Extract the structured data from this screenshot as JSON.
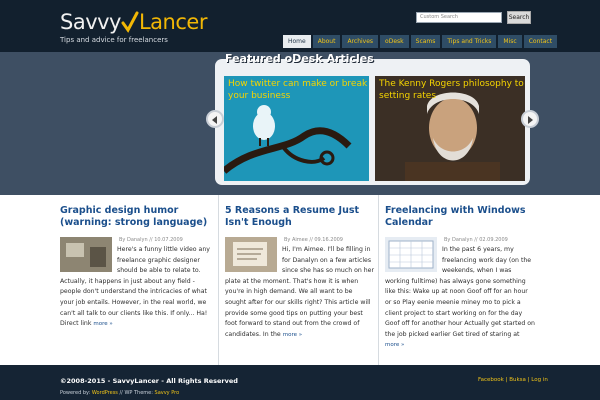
{
  "site": {
    "logo_savvy": "Savvy",
    "logo_lancer": "Lancer",
    "tagline": "Tips and advice for freelancers",
    "brand_color": "#f2b705"
  },
  "search": {
    "placeholder": "Custom Search",
    "button_label": "Search"
  },
  "nav": {
    "items": [
      "Home",
      "About",
      "Archives",
      "oDesk",
      "Scams",
      "Tips and Tricks",
      "Misc",
      "Contact"
    ],
    "active": "Home"
  },
  "featured": {
    "title": "Featured oDesk Articles",
    "slides": [
      {
        "caption": "How twitter can make or break your business"
      },
      {
        "caption": "The Kenny Rogers philosophy to setting rates"
      }
    ],
    "prev_icon": "arrow-left-icon",
    "next_icon": "arrow-right-icon"
  },
  "posts": [
    {
      "title": "Graphic design humor (warning: strong language)",
      "meta": "By Danalyn // 10.07.2009",
      "excerpt": "Here's a funny little video any freelance graphic designer should be able to relate to. Actually, it happens in just about any field - people don't understand the intricacies of what your job entails.  However, in the real world, we can't all talk to our clients like this.  If only... Ha! Direct link",
      "more": "more »"
    },
    {
      "title": "5 Reasons a Resume Just Isn't Enough",
      "meta": "By Aimee // 09.16.2009",
      "excerpt": "Hi, I'm Aimee. I'll be filling in for Danalyn on a few articles since she has so much on her plate at the moment. That's how it is when you're in high demand. We all want to be sought after for our skills right? This article will provide some good tips on putting your best foot forward to stand out from the crowd of candidates. In the",
      "more": "more »"
    },
    {
      "title": "Freelancing with Windows Calendar",
      "meta": "By Danalyn // 02.09.2009",
      "excerpt": "In the past 6 years, my freelancing work day (on the weekends, when I was working fulltime) has always gone something like this: Wake up at noon Goof off for an hour or so Play eenie meenie miney mo to pick a client project to start working on for the day Goof off for another hour Actually get started on the job picked earlier Get tired of staring at",
      "more": "more »"
    }
  ],
  "footer": {
    "copyright": "©2008-2015 - SavvyLancer - All Rights Reserved",
    "powered_prefix": "Powered by: ",
    "powered_wp": "WordPress",
    "powered_mid": " // WP Theme: ",
    "powered_theme": "Savvy Pro",
    "links": [
      "Facebook",
      "Buksa",
      "Log in"
    ],
    "link_sep": " | "
  }
}
